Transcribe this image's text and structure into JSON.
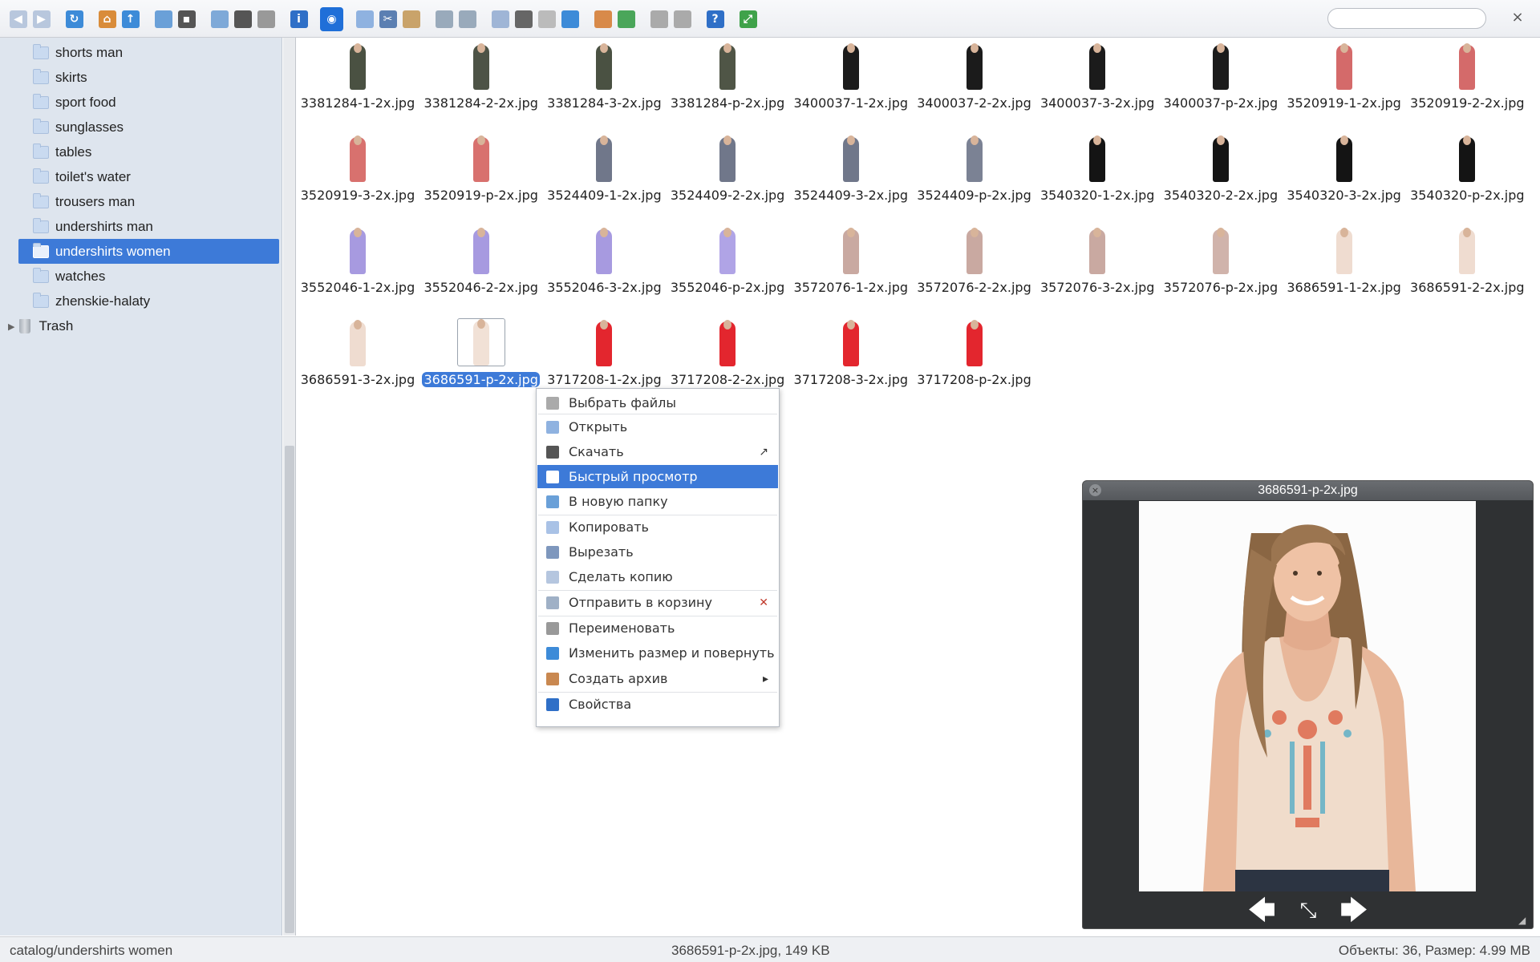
{
  "toolbar": {
    "search_placeholder": "",
    "close_glyph": "×",
    "groups": [
      {
        "icons": [
          "back-icon",
          "forward-icon"
        ]
      },
      {
        "icons": [
          "reload-icon"
        ]
      },
      {
        "icons": [
          "home-icon",
          "up-icon"
        ]
      },
      {
        "icons": [
          "new-folder-icon",
          "save-icon"
        ]
      },
      {
        "icons": [
          "open-icon",
          "download-icon",
          "select-icon"
        ]
      },
      {
        "icons": [
          "info-icon"
        ]
      },
      {
        "icons": [
          "quicklook-icon"
        ]
      },
      {
        "icons": [
          "copy-icon",
          "cut-icon",
          "paste-icon"
        ]
      },
      {
        "icons": [
          "delete-icon",
          "empty-icon"
        ]
      },
      {
        "icons": [
          "duplicate-icon",
          "rename-icon",
          "edit-icon",
          "resize-icon"
        ]
      },
      {
        "icons": [
          "archive-icon",
          "extract-icon"
        ]
      },
      {
        "icons": [
          "view-icon",
          "sort-icon"
        ]
      },
      {
        "icons": [
          "help-icon"
        ]
      },
      {
        "icons": [
          "fullscreen-icon"
        ]
      }
    ]
  },
  "sidebar": {
    "items": [
      {
        "label": "shorts man"
      },
      {
        "label": "skirts"
      },
      {
        "label": "sport food"
      },
      {
        "label": "sunglasses"
      },
      {
        "label": "tables"
      },
      {
        "label": "toilet's water"
      },
      {
        "label": "trousers man"
      },
      {
        "label": "undershirts man"
      },
      {
        "label": "undershirts women",
        "selected": true
      },
      {
        "label": "watches"
      },
      {
        "label": "zhenskie-halaty"
      }
    ],
    "trash_label": "Trash"
  },
  "files": [
    {
      "name": "3381284-1-2x.jpg",
      "color": "#4a5142"
    },
    {
      "name": "3381284-2-2x.jpg",
      "color": "#4d5346"
    },
    {
      "name": "3381284-3-2x.jpg",
      "color": "#4a5142"
    },
    {
      "name": "3381284-p-2x.jpg",
      "color": "#4f5546"
    },
    {
      "name": "3400037-1-2x.jpg",
      "color": "#1b1b1b"
    },
    {
      "name": "3400037-2-2x.jpg",
      "color": "#1b1b1b"
    },
    {
      "name": "3400037-3-2x.jpg",
      "color": "#1b1b1b"
    },
    {
      "name": "3400037-p-2x.jpg",
      "color": "#1b1b1b"
    },
    {
      "name": "3520919-1-2x.jpg",
      "color": "#d46a6a"
    },
    {
      "name": "3520919-2-2x.jpg",
      "color": "#d46a6a"
    },
    {
      "name": "3520919-3-2x.jpg",
      "color": "#d8716e"
    },
    {
      "name": "3520919-p-2x.jpg",
      "color": "#d8716e"
    },
    {
      "name": "3524409-1-2x.jpg",
      "color": "#70778a"
    },
    {
      "name": "3524409-2-2x.jpg",
      "color": "#70778a"
    },
    {
      "name": "3524409-3-2x.jpg",
      "color": "#70778a"
    },
    {
      "name": "3524409-p-2x.jpg",
      "color": "#7b8294"
    },
    {
      "name": "3540320-1-2x.jpg",
      "color": "#141414"
    },
    {
      "name": "3540320-2-2x.jpg",
      "color": "#141414"
    },
    {
      "name": "3540320-3-2x.jpg",
      "color": "#141414"
    },
    {
      "name": "3540320-p-2x.jpg",
      "color": "#141414"
    },
    {
      "name": "3552046-1-2x.jpg",
      "color": "#a79ae0"
    },
    {
      "name": "3552046-2-2x.jpg",
      "color": "#a79ae0"
    },
    {
      "name": "3552046-3-2x.jpg",
      "color": "#a79ae0"
    },
    {
      "name": "3552046-p-2x.jpg",
      "color": "#b0a4e6"
    },
    {
      "name": "3572076-1-2x.jpg",
      "color": "#c9a9a1"
    },
    {
      "name": "3572076-2-2x.jpg",
      "color": "#c9a9a1"
    },
    {
      "name": "3572076-3-2x.jpg",
      "color": "#c9a9a1"
    },
    {
      "name": "3572076-p-2x.jpg",
      "color": "#d0b3ab"
    },
    {
      "name": "3686591-1-2x.jpg",
      "color": "#efdcd0"
    },
    {
      "name": "3686591-2-2x.jpg",
      "color": "#efdcd0"
    },
    {
      "name": "3686591-3-2x.jpg",
      "color": "#efdcd0"
    },
    {
      "name": "3686591-p-2x.jpg",
      "color": "#f1e1d6",
      "selected": true
    },
    {
      "name": "3717208-1-2x.jpg",
      "color": "#e3262e"
    },
    {
      "name": "3717208-2-2x.jpg",
      "color": "#e3262e"
    },
    {
      "name": "3717208-3-2x.jpg",
      "color": "#e3262e"
    },
    {
      "name": "3717208-p-2x.jpg",
      "color": "#e3262e"
    }
  ],
  "context_menu": {
    "items": [
      {
        "label": "Выбрать файлы",
        "icon": "select-files-icon"
      },
      {
        "label": "Открыть",
        "icon": "open-icon"
      },
      {
        "label": "Скачать",
        "icon": "download-icon",
        "extra": "↗"
      },
      {
        "label": "Быстрый просмотр",
        "icon": "quicklook-icon",
        "highlight": true
      },
      {
        "label": "В новую папку",
        "icon": "new-folder-icon"
      },
      {
        "label": "Копировать",
        "icon": "copy-icon"
      },
      {
        "label": "Вырезать",
        "icon": "cut-icon"
      },
      {
        "label": "Сделать копию",
        "icon": "duplicate-icon"
      },
      {
        "label": "Отправить в корзину",
        "icon": "trash-icon",
        "extra": "✕"
      },
      {
        "label": "Переименовать",
        "icon": "rename-icon"
      },
      {
        "label": "Изменить размер и повернуть",
        "icon": "resize-icon"
      },
      {
        "label": "Создать архив",
        "icon": "archive-icon",
        "extra": "▸"
      },
      {
        "label": "Свойства",
        "icon": "info-icon"
      }
    ]
  },
  "quicklook": {
    "title": "3686591-p-2x.jpg",
    "prev_glyph": "🡄",
    "expand_glyph": "⤡",
    "next_glyph": "🡆"
  },
  "status": {
    "path": "catalog/undershirts women",
    "file": "3686591-p-2x.jpg, 149 KB",
    "stats": "Объекты: 36, Размер: 4.99 MB"
  }
}
